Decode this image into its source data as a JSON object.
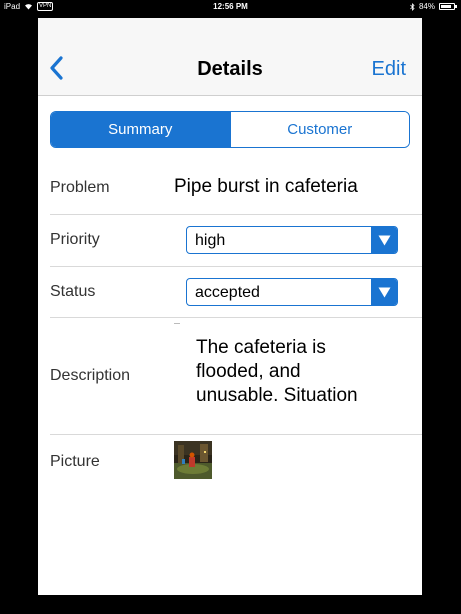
{
  "status_bar": {
    "device": "iPad",
    "carrier_icon": "wifi-icon",
    "network_label": "VPN",
    "time": "12:56 PM",
    "bluetooth_icon": "bluetooth-icon",
    "battery_percent": "84%",
    "battery_level": 0.84
  },
  "nav": {
    "back_icon": "chevron-left-icon",
    "title": "Details",
    "edit_label": "Edit"
  },
  "segments": {
    "summary": "Summary",
    "customer": "Customer",
    "selected": "Summary"
  },
  "fields": {
    "problem_label": "Problem",
    "problem_value": "Pipe burst in cafeteria",
    "priority_label": "Priority",
    "priority_value": "high",
    "status_label": "Status",
    "status_value": "accepted",
    "description_label": "Description",
    "description_value": "The cafeteria is flooded, and unusable. Situation",
    "picture_label": "Picture"
  },
  "colors": {
    "accent": "#1a74d1",
    "background": "#000000",
    "nav_background": "#f7f7f7"
  }
}
